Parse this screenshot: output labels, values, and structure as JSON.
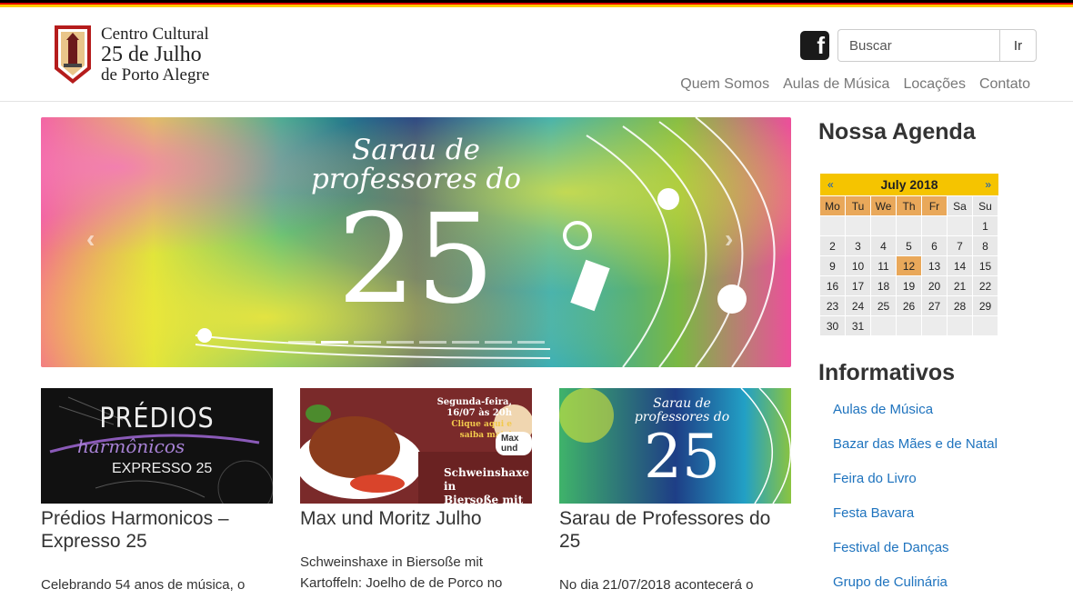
{
  "header": {
    "logo": {
      "line1": "Centro Cultural",
      "line2": "25 de Julho",
      "line3": "de Porto Alegre"
    },
    "facebook_icon": "facebook-icon",
    "search": {
      "placeholder": "Buscar",
      "button_label": "Ir"
    },
    "nav": [
      "Quem Somos",
      "Aulas de Música",
      "Locações",
      "Contato"
    ]
  },
  "carousel": {
    "slide_text": {
      "line1": "Sarau de",
      "line2": "professores do",
      "number": "25"
    },
    "prev_icon": "chevron-left-icon",
    "next_icon": "chevron-right-icon",
    "indicator_count": 8,
    "active_indicator": 1
  },
  "posts": [
    {
      "title": "Prédios Harmonicos – Expresso 25",
      "excerpt": "Celebrando 54 anos de música, o",
      "thumb_text": {
        "line1": "PRÉDIOS",
        "line2": "harmônicos",
        "line3": "EXPRESSO 25"
      }
    },
    {
      "title": "Max und Moritz Julho",
      "excerpt": "Schweinshaxe in Biersoße mit Kartoffeln:  Joelho de de Porco no",
      "thumb_text": {
        "top1": "Segunda-feira,",
        "top2": "16/07 às 20h",
        "top3": "Clique aqui e saiba mais!",
        "badge": "Max und",
        "bottom1": "Schweinshaxe in",
        "bottom2": "Biersoße mit Ka"
      }
    },
    {
      "title": "Sarau de Professores do 25",
      "excerpt": "No dia 21/07/2018 acontecerá o",
      "thumb_text": {
        "line1": "Sarau de",
        "line2": "professores do",
        "number": "25"
      }
    }
  ],
  "sidebar": {
    "agenda_title": "Nossa Agenda",
    "calendar": {
      "prev": "«",
      "next": "»",
      "month": "July 2018",
      "weekdays": [
        "Mo",
        "Tu",
        "We",
        "Th",
        "Fr",
        "Sa",
        "Su"
      ],
      "leading_blanks": 6,
      "days": [
        "1",
        "2",
        "3",
        "4",
        "5",
        "6",
        "7",
        "8",
        "9",
        "10",
        "11",
        "12",
        "13",
        "14",
        "15",
        "16",
        "17",
        "18",
        "19",
        "20",
        "21",
        "22",
        "23",
        "24",
        "25",
        "26",
        "27",
        "28",
        "29",
        "30",
        "31"
      ],
      "today": "12"
    },
    "info_title": "Informativos",
    "info_links": [
      "Aulas de Música",
      "Bazar das Mães e de Natal",
      "Feira do Livro",
      "Festa Bavara",
      "Festival de Danças",
      "Grupo de Culinária"
    ]
  },
  "colors": {
    "flag_black": "#000000",
    "flag_red": "#dd0000",
    "flag_gold": "#ffce00",
    "nav_text": "#777777",
    "link": "#1e73be",
    "calendar_head": "#f5c400",
    "calendar_accent": "#e9a85a"
  }
}
